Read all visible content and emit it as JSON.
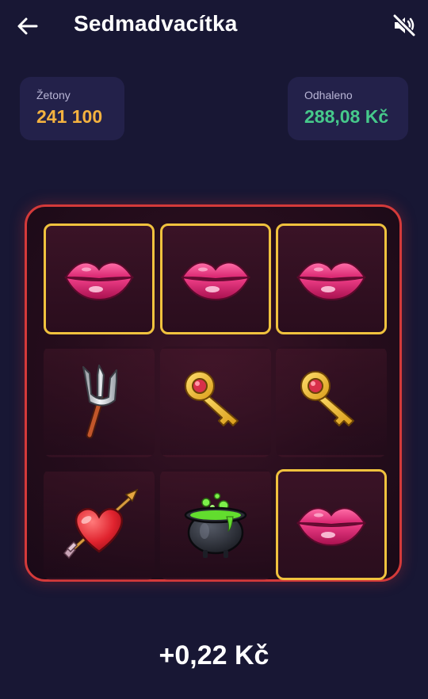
{
  "header": {
    "title": "Sedmadvacítka",
    "back_icon": "arrow-left-icon",
    "mute_icon": "volume-muted-icon"
  },
  "stats": {
    "tokens": {
      "label": "Žetony",
      "value": "241 100",
      "color": "#f4b23f"
    },
    "revealed": {
      "label": "Odhaleno",
      "value": "288,08 Kč",
      "color": "#46c98b"
    }
  },
  "board": {
    "border_color": "#d43a3a",
    "highlight_color": "#f0c23e",
    "rows": [
      [
        {
          "symbol": "lips",
          "winning": true
        },
        {
          "symbol": "lips",
          "winning": true
        },
        {
          "symbol": "lips",
          "winning": true
        }
      ],
      [
        {
          "symbol": "trident",
          "winning": false
        },
        {
          "symbol": "key",
          "winning": false
        },
        {
          "symbol": "key",
          "winning": false
        }
      ],
      [
        {
          "symbol": "heart-arrow",
          "winning": false
        },
        {
          "symbol": "cauldron",
          "winning": false
        },
        {
          "symbol": "lips",
          "winning": true
        }
      ]
    ]
  },
  "payout": "+0,22 Kč"
}
